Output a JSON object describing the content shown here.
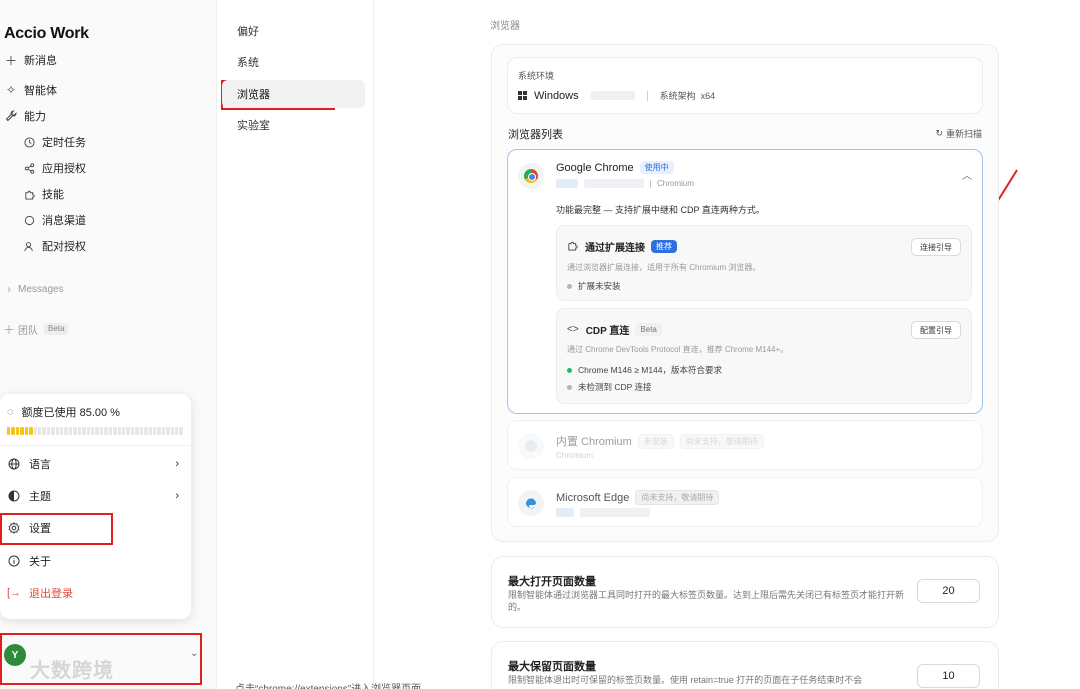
{
  "sidebar": {
    "logo": "Accio Work",
    "new_message": "新消息",
    "agents": "智能体",
    "capabilities": "能力",
    "sub_items": [
      "定时任务",
      "应用授权",
      "技能",
      "消息渠道",
      "配对授权"
    ],
    "messages": "Messages",
    "team": "团队",
    "team_badge": "Beta"
  },
  "popup": {
    "quota_text": "额度已使用 85.00 %",
    "quota_fraction": 0.85,
    "language": "语言",
    "theme": "主题",
    "settings": "设置",
    "about": "关于",
    "logout": "退出登录",
    "accent_danger": "#e0483c"
  },
  "user": {
    "avatar_letter": "Y",
    "watermark": "大数跨境"
  },
  "settings_nav": [
    "偏好",
    "系统",
    "浏览器",
    "实验室"
  ],
  "browser_page": {
    "section_title": "浏览器",
    "env": {
      "label": "系统环境",
      "os": "Windows",
      "arch_label": "系统架构",
      "arch_value": "x64"
    },
    "list_title": "浏览器列表",
    "rescan": "重新扫描",
    "chrome": {
      "name": "Google Chrome",
      "badge": "使用中",
      "engine": "Chromium",
      "desc": "功能最完整 — 支持扩展中继和 CDP 直连两种方式。",
      "ext": {
        "title": "通过扩展连接",
        "badge": "推荐",
        "desc": "通过浏览器扩展连接，适用于所有 Chromium 浏览器。",
        "status": "扩展未安装",
        "button": "连接引导"
      },
      "cdp": {
        "title": "CDP 直连",
        "badge": "Beta",
        "desc": "通过 Chrome DevTools Protocol 直连，推荐 Chrome M144+。",
        "status_ok": "Chrome M146 ≥ M144，版本符合要求",
        "status_missing": "未检测到 CDP 连接",
        "button": "配置引导"
      }
    },
    "builtin": {
      "name": "内置 Chromium",
      "badge1": "未安装",
      "badge2": "尚未支持，敬请期待",
      "engine": "Chromium"
    },
    "edge": {
      "name": "Microsoft Edge",
      "badge": "尚未支持，敬请期待"
    }
  },
  "max_pages": {
    "title": "最大打开页面数量",
    "desc": "限制智能体通过浏览器工具同时打开的最大标签页数量。达到上限后需先关闭已有标签页才能打开新的。",
    "value": "20"
  },
  "max_keep": {
    "title": "最大保留页面数量",
    "desc": "限制智能体退出时可保留的标签页数量。使用 retain=true 打开的页面在子任务结束时不会",
    "value": "10"
  },
  "bottom_text": "点击“chrome://extensions”进入浏览器页面",
  "colors": {
    "highlight": "#e02020",
    "active_badge": "#2f6fe0",
    "quota_fill": "#f5c518"
  }
}
